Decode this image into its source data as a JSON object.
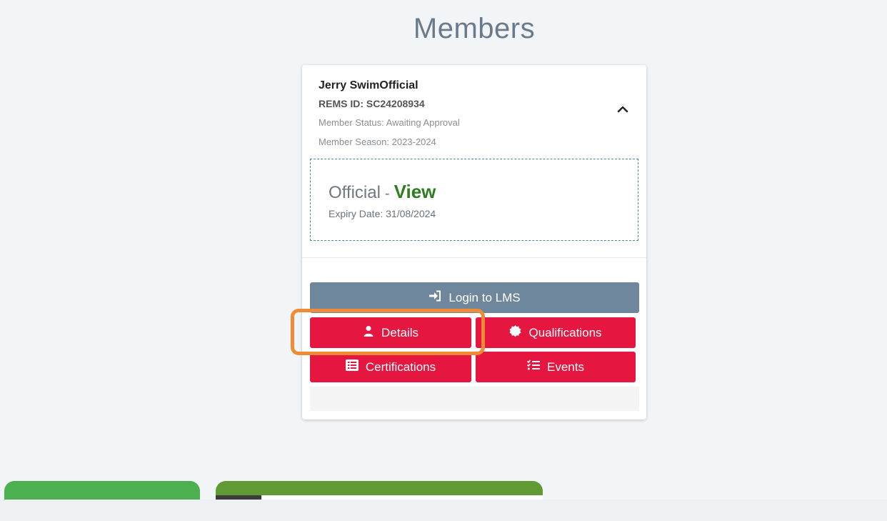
{
  "page": {
    "title": "Members"
  },
  "member": {
    "name": "Jerry SwimOfficial",
    "rems_id": "REMS ID: SC24208934",
    "status": "Member Status: Awaiting Approval",
    "season": "Member Season: 2023-2024"
  },
  "membership": {
    "type": "Official",
    "separator": "-",
    "view_label": "View",
    "expiry": "Expiry Date: 31/08/2024"
  },
  "actions": {
    "login_lms": "Login to LMS",
    "details": "Details",
    "qualifications": "Qualifications",
    "certifications": "Certifications",
    "events": "Events"
  },
  "icons": {
    "chevron": "chevron-up-icon",
    "login": "sign-in-icon",
    "details": "user-icon",
    "qualifications": "badge-icon",
    "certifications": "list-alt-icon",
    "events": "tasks-list-icon"
  },
  "colors": {
    "primary_red": "#e5163f",
    "lms_gray": "#6f879c",
    "view_green": "#2e7d1e",
    "highlight_orange": "#ef8b34"
  }
}
